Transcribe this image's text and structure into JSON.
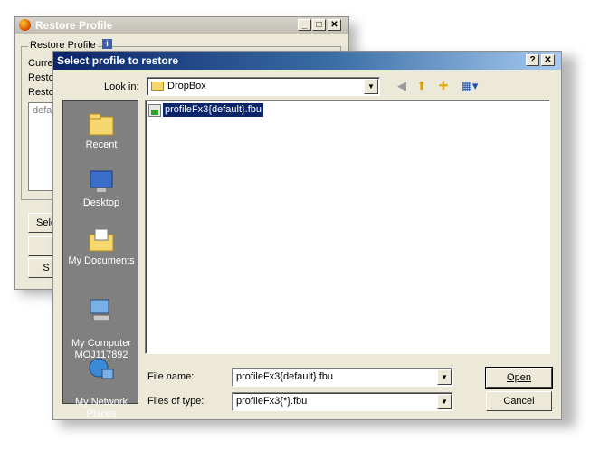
{
  "back_window": {
    "title": "Restore Profile",
    "group_label": "Restore Profile",
    "row1_label": "Curre",
    "row2_label": "Resto",
    "row3_label": "Resto",
    "list_text": "defa",
    "button_select": "Sele",
    "button_other": "S"
  },
  "dialog": {
    "title": "Select profile to restore",
    "look_in_label": "Look in:",
    "look_in_value": "DropBox",
    "places": [
      {
        "label": "Recent"
      },
      {
        "label": "Desktop"
      },
      {
        "label": "My Documents"
      },
      {
        "label": "My Computer\nMOJ117892"
      },
      {
        "label": "My Network\nPlaces"
      }
    ],
    "files": [
      {
        "name": "profileFx3{default}.fbu"
      }
    ],
    "file_name_label": "File name:",
    "file_name_value": "profileFx3{default}.fbu",
    "files_of_type_label": "Files of type:",
    "files_of_type_value": "profileFx3{*}.fbu",
    "open_label": "Open",
    "cancel_label": "Cancel",
    "help_label": "?",
    "close_label": "✕"
  },
  "icons": {
    "back": "back-icon",
    "up": "up-folder-icon",
    "new_folder": "new-folder-icon",
    "views": "views-icon"
  }
}
